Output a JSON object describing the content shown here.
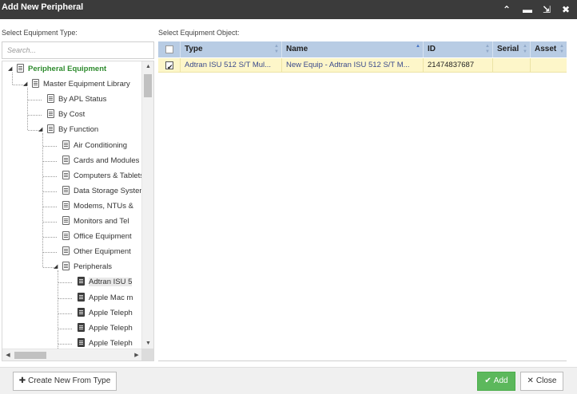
{
  "window": {
    "title": "Add New Peripheral",
    "controls": [
      "chevron-up",
      "minimize",
      "expand",
      "close"
    ]
  },
  "left": {
    "label": "Select Equipment Type:",
    "search_placeholder": "Search...",
    "tree": [
      {
        "label": "Peripheral Equipment",
        "level": 0,
        "expanded": true,
        "root": true
      },
      {
        "label": "Master Equipment Library",
        "level": 1,
        "expanded": true
      },
      {
        "label": "By APL Status",
        "level": 2,
        "expanded": false
      },
      {
        "label": "By Cost",
        "level": 2,
        "expanded": false
      },
      {
        "label": "By Function",
        "level": 2,
        "expanded": true
      },
      {
        "label": "Air Conditioning",
        "level": 3,
        "expanded": false
      },
      {
        "label": "Cards and Modules",
        "level": 3,
        "expanded": false
      },
      {
        "label": "Computers & Tablets",
        "level": 3,
        "expanded": false
      },
      {
        "label": "Data Storage Systems",
        "level": 3,
        "expanded": false
      },
      {
        "label": "Modems, NTUs &",
        "level": 3,
        "expanded": false
      },
      {
        "label": "Monitors and Tel",
        "level": 3,
        "expanded": false
      },
      {
        "label": "Office Equipment",
        "level": 3,
        "expanded": false
      },
      {
        "label": "Other Equipment",
        "level": 3,
        "expanded": false
      },
      {
        "label": "Peripherals",
        "level": 3,
        "expanded": true
      },
      {
        "label": "Adtran ISU 5",
        "level": 4,
        "leaf": true,
        "selected": true
      },
      {
        "label": "Apple Mac m",
        "level": 4,
        "leaf": true
      },
      {
        "label": "Apple Teleph",
        "level": 4,
        "leaf": true
      },
      {
        "label": "Apple Teleph",
        "level": 4,
        "leaf": true
      },
      {
        "label": "Apple Teleph",
        "level": 4,
        "leaf": true
      }
    ]
  },
  "right": {
    "label": "Select Equipment Object:",
    "columns": [
      "",
      "Type",
      "Name",
      "ID",
      "Serial",
      "Asset"
    ],
    "rows": [
      {
        "checked": true,
        "type": "Adtran ISU 512 S/T Mul...",
        "name": "New Equip - Adtran ISU 512 S/T M...",
        "id": "21474837687",
        "serial": "",
        "asset": ""
      }
    ]
  },
  "footer": {
    "create_label": "Create New From Type",
    "add_label": "Add",
    "close_label": "Close"
  },
  "colors": {
    "titlebar": "#3b3b3b",
    "root_node": "#2e8b2e",
    "grid_header": "#b8cce4",
    "selected_row": "#fdf6c9",
    "add_button": "#5cb85c"
  }
}
